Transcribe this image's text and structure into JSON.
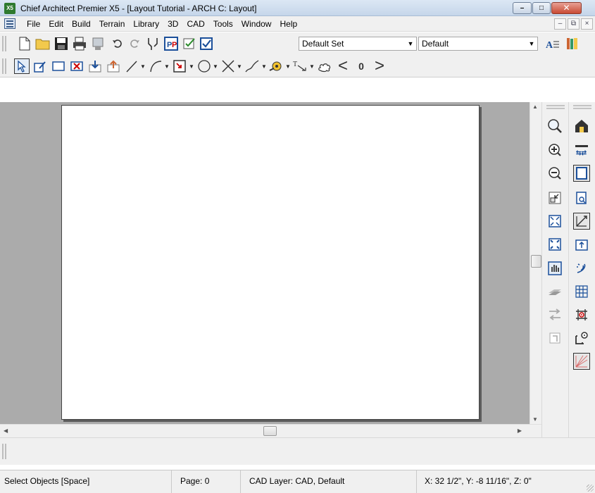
{
  "window": {
    "title": "Chief Architect Premier X5 - [Layout Tutorial - ARCH C: Layout]",
    "app_icon_text": "X5",
    "minimize_glyph": "–",
    "maximize_glyph": "□",
    "close_glyph": "✕"
  },
  "menubar": {
    "items": [
      "File",
      "Edit",
      "Build",
      "Terrain",
      "Library",
      "3D",
      "CAD",
      "Tools",
      "Window",
      "Help"
    ],
    "mdi_minimize": "–",
    "mdi_restore": "⧉",
    "mdi_close": "×"
  },
  "toolbar1": {
    "layer_set": "Default Set",
    "text_style": "Default"
  },
  "toolbar2": {
    "text_tool_glyph": "T",
    "angle_left": "<",
    "zero": "0",
    "angle_right": ">"
  },
  "statusbar": {
    "mode": "Select Objects [Space]",
    "page": "Page: 0",
    "layer": "CAD Layer: CAD,  Default",
    "coords": "X: 32 1/2\", Y: -8 11/16\", Z: 0\""
  },
  "colors": {
    "title_gradient_top": "#dce7f4",
    "workspace_gray": "#ababab",
    "paper": "#ffffff",
    "close_button": "#c94a33"
  },
  "icons": {
    "toolbar1": [
      "new-icon",
      "open-folder-icon",
      "save-icon",
      "print-icon",
      "print-preview-icon",
      "undo-icon",
      "redo-icon",
      "preferences-icon",
      "layer-display-icon",
      "plan-check-icon",
      "checkbox-icon",
      "text-style-icon",
      "library-icon"
    ],
    "toolbar2": [
      "select-objects-icon",
      "edit-icon",
      "open-object-icon",
      "delete-icon",
      "send-to-layout-icon",
      "layout-box-icon",
      "line-icon",
      "arc-icon",
      "cad-box-icon",
      "circle-icon",
      "dimension-icon",
      "spline-icon",
      "tape-measure-icon",
      "text-icon",
      "revision-cloud-icon"
    ],
    "right_column_1": [
      "zoom-icon",
      "zoom-in-icon",
      "zoom-out-icon",
      "undo-zoom-icon",
      "fill-window-icon",
      "fill-window-all-icon",
      "pan-icon",
      "layer-icon",
      "swap-icon",
      "rotate-icon"
    ],
    "right_column_2": [
      "3d-view-icon",
      "reference-icon",
      "page-border-icon",
      "page-setup-icon",
      "dimension-line-icon",
      "export-icon",
      "spiral-icon",
      "grid-icon",
      "snap-icon",
      "object-snap-icon",
      "angle-snap-icon"
    ]
  }
}
